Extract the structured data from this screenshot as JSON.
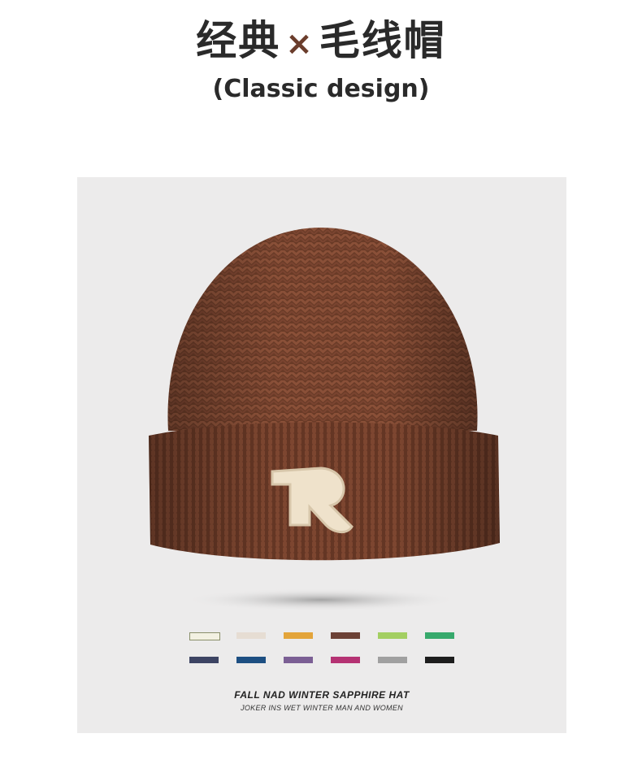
{
  "header": {
    "title_left": "经典",
    "title_sep": "×",
    "title_right": "毛线帽",
    "subtitle": "(Classic design)"
  },
  "product": {
    "badge_letter": "R",
    "swatch_colors": [
      "#f3f1e2",
      "#e6ddd3",
      "#e3a43a",
      "#6c4136",
      "#a3cf62",
      "#37a96c",
      "#3d4463",
      "#1d4f82",
      "#7b5f94",
      "#b53273",
      "#a0a0a0",
      "#1d1d1d"
    ],
    "caption_main": "FALL NAD WINTER SAPPHIRE HAT",
    "caption_sub": "JOKER INS WET WINTER MAN AND WOMEN"
  }
}
